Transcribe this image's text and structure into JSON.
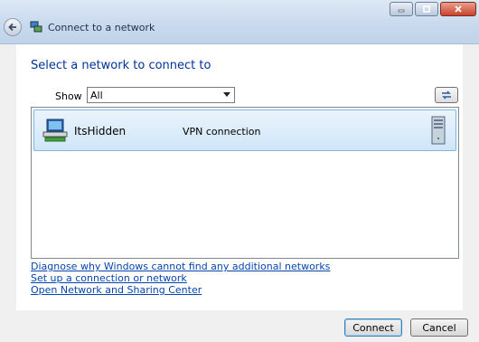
{
  "window": {
    "title": "Connect to a network",
    "back_icon": "back-arrow-icon",
    "app_icon": "network-icon",
    "caption_buttons": [
      "minimize-icon",
      "maximize-icon",
      "close-icon"
    ]
  },
  "main": {
    "heading": "Select a network to connect to",
    "show_label": "Show",
    "show_value": "All",
    "refresh_icon": "refresh-icon"
  },
  "networks": [
    {
      "name": "ItsHidden",
      "type": "VPN connection",
      "icon": "computer-network-icon",
      "signal_icon": "server-icon"
    }
  ],
  "links": [
    "Diagnose why Windows cannot find any additional networks",
    "Set up a connection or network",
    "Open Network and Sharing Center"
  ],
  "buttons": {
    "connect": "Connect",
    "cancel": "Cancel"
  },
  "colors": {
    "heading": "#003399",
    "link": "#0645ad",
    "selection": "#cfe6f8"
  }
}
